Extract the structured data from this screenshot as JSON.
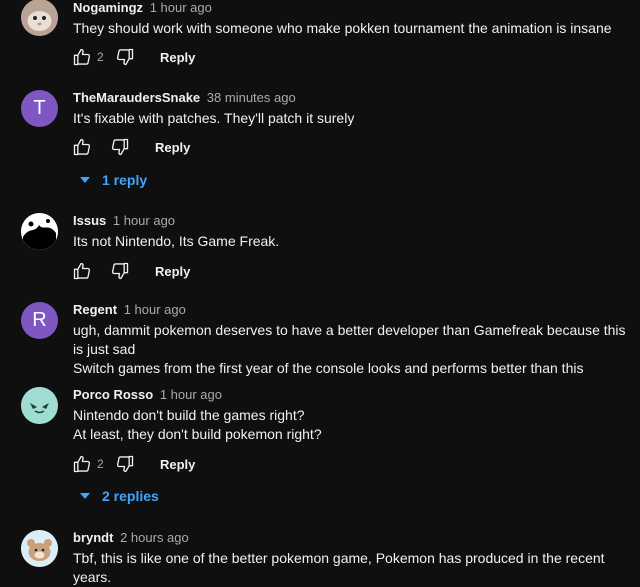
{
  "comments": [
    {
      "author": "Nogamingz",
      "time": "1 hour ago",
      "text": [
        "They should work with someone who make pokken tournament the animation is insane"
      ],
      "likes": "2",
      "reply_label": "Reply"
    },
    {
      "author": "TheMaraudersSnake",
      "time": "38 minutes ago",
      "avatar_letter": "T",
      "text": [
        "It's fixable with patches. They'll patch it surely"
      ],
      "likes": "",
      "reply_label": "Reply",
      "replies_label": "1 reply"
    },
    {
      "author": "Issus",
      "time": "1 hour ago",
      "text": [
        "Its not Nintendo, Its Game Freak."
      ],
      "likes": "",
      "reply_label": "Reply"
    },
    {
      "author": "Regent",
      "time": "1 hour ago",
      "avatar_letter": "R",
      "text": [
        "ugh, dammit pokemon deserves to have a better developer than Gamefreak because this is just sad",
        "Switch games from the first year of the console looks and performs better than this"
      ]
    },
    {
      "author": "Porco Rosso",
      "time": "1 hour ago",
      "text": [
        "Nintendo don't build the games right?",
        "At least, they don't build pokemon right?"
      ],
      "likes": "2",
      "reply_label": "Reply",
      "replies_label": "2 replies"
    },
    {
      "author": "bryndt",
      "time": "2 hours ago",
      "text": [
        "Tbf, this is like one of the better pokemon game, Pokemon has produced in the recent years."
      ]
    }
  ],
  "colors": {
    "background": "#0f0f0f",
    "link": "#3ea6ff",
    "avatar_t": "#7e57c2",
    "avatar_r": "#7e57c2"
  },
  "icons": [
    "thumbs-up-icon",
    "thumbs-down-icon",
    "caret-down-icon"
  ]
}
